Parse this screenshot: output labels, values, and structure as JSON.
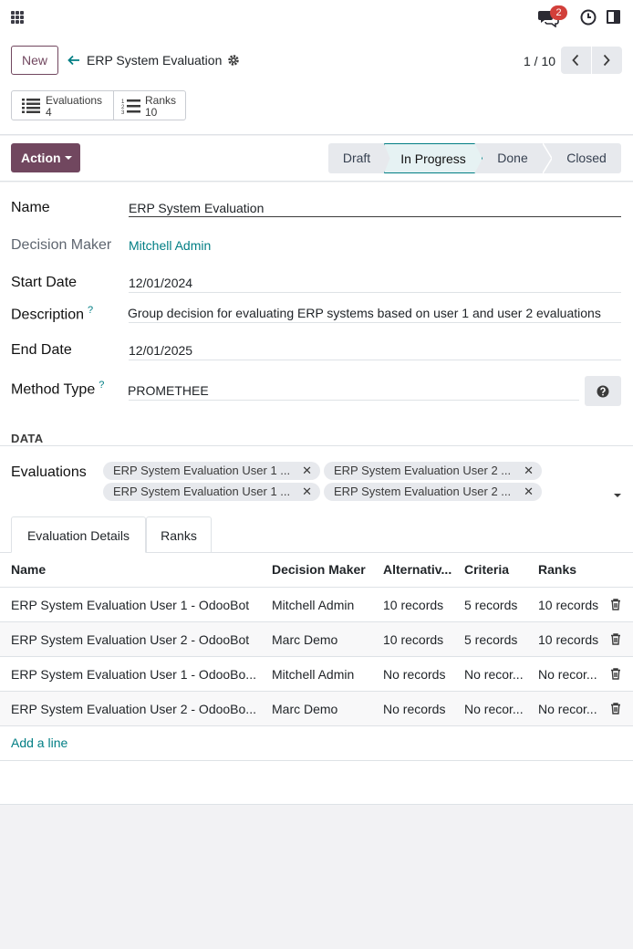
{
  "topbar": {
    "chat_badge": "2",
    "icons": [
      "apps-icon",
      "chat-icon",
      "clock-icon",
      "panel-icon"
    ]
  },
  "control": {
    "new_label": "New",
    "breadcrumb": "ERP System Evaluation",
    "pager": "1 / 10"
  },
  "smart_buttons": [
    {
      "label": "Evaluations",
      "count": "4",
      "icon": "list-icon"
    },
    {
      "label": "Ranks",
      "count": "10",
      "icon": "ordered-list-icon"
    }
  ],
  "status": {
    "action_label": "Action",
    "stages": [
      "Draft",
      "In Progress",
      "Done",
      "Closed"
    ],
    "current": "In Progress"
  },
  "form": {
    "name_label": "Name",
    "name_value": "ERP System Evaluation",
    "decision_maker_label": "Decision Maker",
    "decision_maker_value": "Mitchell Admin",
    "start_date_label": "Start Date",
    "start_date_value": "12/01/2024",
    "description_label": "Description",
    "description_value": "Group decision for evaluating ERP systems based on user 1 and user 2 evaluations",
    "end_date_label": "End Date",
    "end_date_value": "12/01/2025",
    "method_type_label": "Method Type",
    "method_type_value": "PROMETHEE",
    "tooltip_mark": "?"
  },
  "data_section": {
    "title": "DATA",
    "evaluations_label": "Evaluations",
    "tags": [
      "ERP System Evaluation User 1 ...",
      "ERP System Evaluation User 2 ...",
      "ERP System Evaluation User 1 ...",
      "ERP System Evaluation User 2 ..."
    ]
  },
  "tabs": [
    "Evaluation Details",
    "Ranks"
  ],
  "table": {
    "headers": [
      "Name",
      "Decision Maker",
      "Alternativ...",
      "Criteria",
      "Ranks"
    ],
    "rows": [
      [
        "ERP System Evaluation User 1 - OdooBot",
        "Mitchell Admin",
        "10 records",
        "5 records",
        "10 records"
      ],
      [
        "ERP System Evaluation User 2 - OdooBot",
        "Marc Demo",
        "10 records",
        "5 records",
        "10 records"
      ],
      [
        "ERP System Evaluation User 1 - OdooBo...",
        "Mitchell Admin",
        "No records",
        "No recor...",
        "No recor..."
      ],
      [
        "ERP System Evaluation User 2 - OdooBo...",
        "Marc Demo",
        "No records",
        "No recor...",
        "No recor..."
      ]
    ],
    "add_line": "Add a line"
  },
  "colors": {
    "primary": "#71475f",
    "link": "#017e84",
    "badge": "#d23f3a"
  }
}
